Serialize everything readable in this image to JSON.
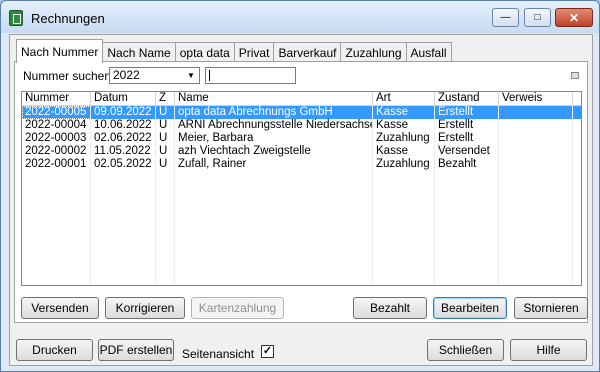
{
  "window": {
    "title": "Rechnungen"
  },
  "titlebar_buttons": {
    "minimize": "—",
    "maximize": "□",
    "close": "✕"
  },
  "tabs": [
    "Nach Nummer",
    "Nach Name",
    "opta data",
    "Privat",
    "Barverkauf",
    "Zuzahlung",
    "Ausfall"
  ],
  "search": {
    "label": "Nummer suchen",
    "year": "2022",
    "text": ""
  },
  "table": {
    "columns": [
      "Nummer",
      "Datum",
      "Z",
      "Name",
      "Art",
      "Zustand",
      "Verweis",
      ""
    ],
    "rows": [
      [
        "2022-00005",
        "09.09.2022",
        "Ü",
        "opta data Abrechnungs GmbH",
        "Kasse",
        "Erstellt",
        ""
      ],
      [
        "2022-00004",
        "10.06.2022",
        "Ü",
        "ARNI Abrechnungsstelle Niedersachsen GmbH",
        "Kasse",
        "Erstellt",
        ""
      ],
      [
        "2022-00003",
        "02.06.2022",
        "Ü",
        "Meier, Barbara",
        "Zuzahlung",
        "Erstellt",
        ""
      ],
      [
        "2022-00002",
        "11.05.2022",
        "Ü",
        "azh Viechtach Zweigstelle",
        "Kasse",
        "Versendet",
        ""
      ],
      [
        "2022-00001",
        "02.05.2022",
        "Ü",
        "Zufall, Rainer",
        "Zuzahlung",
        "Bezahlt",
        ""
      ]
    ]
  },
  "panel_buttons": {
    "versenden": "Versenden",
    "korrigieren": "Korrigieren",
    "kartenzahlung": "Kartenzahlung",
    "bezahlt": "Bezahlt",
    "bearbeiten": "Bearbeiten",
    "stornieren": "Stornieren"
  },
  "footer": {
    "drucken": "Drucken",
    "pdf": "PDF erstellen",
    "seitenansicht_label": "Seitenansicht",
    "seitenansicht_checked": "✓",
    "schliessen": "Schließen",
    "hilfe": "Hilfe"
  }
}
